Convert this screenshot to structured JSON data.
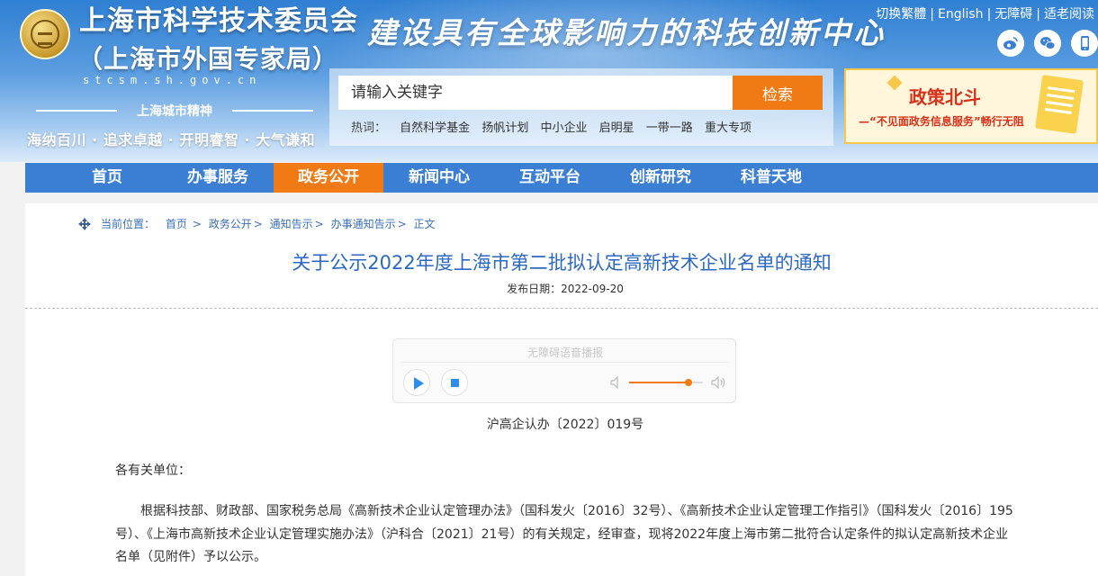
{
  "header": {
    "org_name_line1": "上海市科学技术委员会",
    "org_name_line2": "（上海市外国专家局）",
    "domain": "stcsm.sh.gov.cn",
    "spirit_label": "上海城市精神",
    "motto": "海纳百川 · 追求卓越 · 开明睿智 · 大气谦和",
    "slogan": "建设具有全球影响力的科技创新中心",
    "top_links": [
      "切换繁體",
      "English",
      "无障碍",
      "适老阅读"
    ],
    "social_icons": [
      "weibo-icon",
      "wechat-icon",
      "mobile-icon"
    ]
  },
  "search": {
    "placeholder": "请输入关键字",
    "button_label": "检索",
    "hot_label": "热词：",
    "hot_words": [
      "自然科学基金",
      "扬帆计划",
      "中小企业",
      "启明星",
      "一带一路",
      "重大专项"
    ]
  },
  "banner": {
    "title": "政策北斗",
    "subtitle": "—“不见面政务信息服务”畅行无阻"
  },
  "nav": {
    "items": [
      "首页",
      "办事服务",
      "政务公开",
      "新闻中心",
      "互动平台",
      "创新研究",
      "科普天地"
    ],
    "active_index": 2
  },
  "breadcrumb": {
    "label": "当前位置：",
    "items": [
      "首页",
      "政务公开",
      "通知告示",
      "办事通知告示",
      "正文"
    ]
  },
  "article": {
    "title": "关于公示2022年度上海市第二批拟认定高新技术企业名单的通知",
    "date_label": "发布日期：",
    "date": "2022-09-20",
    "doc_number": "沪高企认办〔2022〕019号",
    "salutation": "各有关单位：",
    "body": "根据科技部、财政部、国家税务总局《高新技术企业认定管理办法》（国科发火〔2016〕32号）、《高新技术企业认定管理工作指引》（国科发火〔2016〕195号）、《上海市高新技术企业认定管理实施办法》（沪科合〔2021〕21号）的有关规定，经审查，现将2022年度上海市第二批符合认定条件的拟认定高新技术企业名单（见附件）予以公示。"
  },
  "audio_player": {
    "title": "无障碍语音播报",
    "volume": 0.8
  },
  "colors": {
    "accent": "#f27a14",
    "nav_blue": "#3a7fd4",
    "title_blue": "#2b69c4"
  }
}
